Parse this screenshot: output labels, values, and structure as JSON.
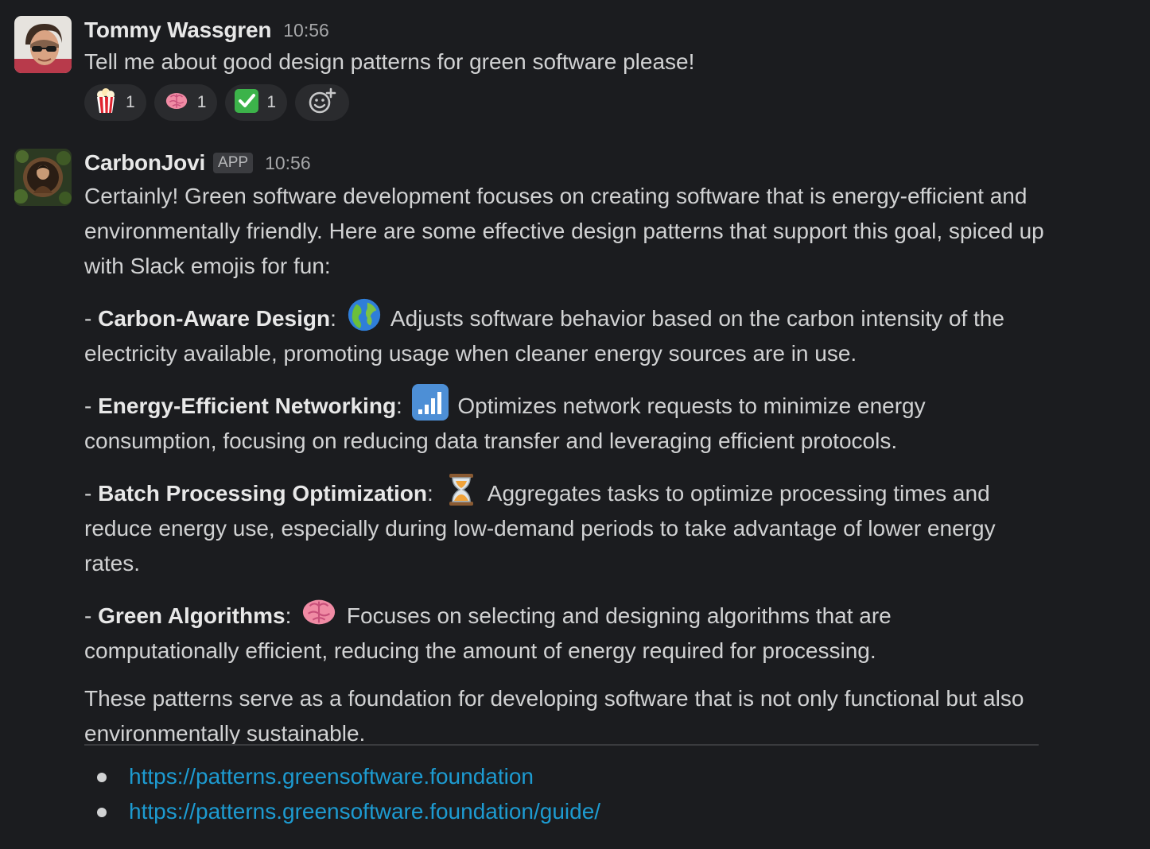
{
  "messages": [
    {
      "author": "Tommy Wassgren",
      "time": "10:56",
      "text": "Tell me about good design patterns for green software please!",
      "reactions": [
        {
          "emoji": "popcorn-icon",
          "count": "1"
        },
        {
          "emoji": "brain-icon",
          "count": "1"
        },
        {
          "emoji": "white-check-mark-icon",
          "count": "1"
        }
      ],
      "add_reaction_icon": "add-reaction-icon"
    },
    {
      "author": "CarbonJovi",
      "badge": "APP",
      "time": "10:56",
      "intro": "Certainly! Green software development focuses on creating software that is energy-efficient and environmentally friendly. Here are some effective design patterns that support this goal, spiced up with Slack emojis for fun:",
      "patterns": [
        {
          "prefix": "- ",
          "name": "Carbon-Aware Design",
          "colon": ":",
          "emoji": "globe-icon",
          "description": "Adjusts software behavior based on the carbon intensity of the electricity available, promoting usage when cleaner energy sources are in use."
        },
        {
          "prefix": "- ",
          "name": "Energy-Efficient Networking",
          "colon": ":",
          "emoji": "signal-strength-icon",
          "description": "Optimizes network requests to minimize energy consumption, focusing on reducing data transfer and leveraging efficient protocols."
        },
        {
          "prefix": "- ",
          "name": "Batch Processing Optimization",
          "colon": ":",
          "emoji": "hourglass-icon",
          "description": "Aggregates tasks to optimize processing times and reduce energy use, especially during low-demand periods to take advantage of lower energy rates."
        },
        {
          "prefix": "- ",
          "name": "Green Algorithms",
          "colon": ":",
          "emoji": "brain-icon",
          "description": "Focuses on selecting and designing algorithms that are computationally efficient, reducing the amount of energy required for processing."
        }
      ],
      "conclusion": "These patterns serve as a foundation for developing software that is not only functional but also environmentally sustainable.",
      "links": [
        "https://patterns.greensoftware.foundation",
        "https://patterns.greensoftware.foundation/guide/"
      ]
    }
  ],
  "colors": {
    "background": "#1b1c1f",
    "text": "#d1d2d3",
    "link": "#1d9bd1",
    "reaction_bg": "#2a2b2e"
  }
}
